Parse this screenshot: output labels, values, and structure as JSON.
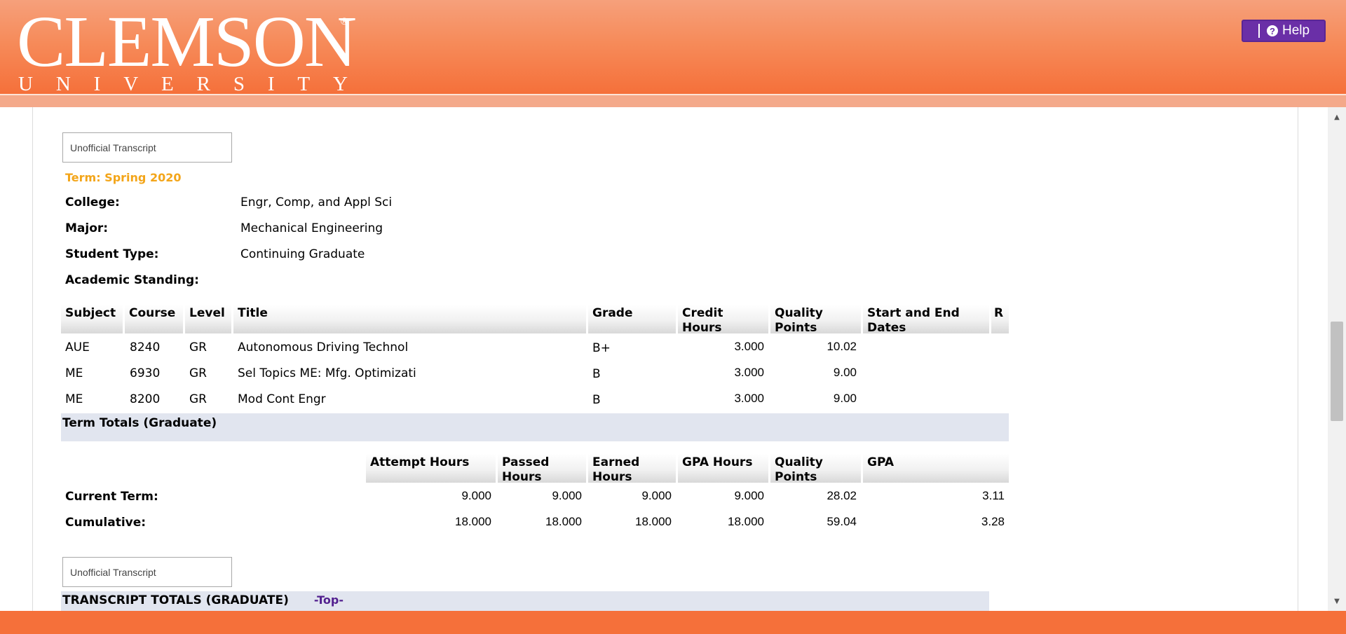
{
  "header": {
    "logo_main": "CLEMSON",
    "logo_sub": [
      "U",
      "N",
      "I",
      "V",
      "E",
      "R",
      "S",
      "I",
      "T",
      "Y"
    ],
    "logo_reg": "®",
    "help_label": "Help",
    "help_icon": "question-circle-icon"
  },
  "section1": {
    "title_box": "Unofficial Transcript",
    "term": "Term: Spring 2020",
    "info": [
      {
        "label": "College:",
        "value": "Engr, Comp, and Appl Sci"
      },
      {
        "label": "Major:",
        "value": "Mechanical Engineering"
      },
      {
        "label": "Student Type:",
        "value": "Continuing Graduate"
      },
      {
        "label": "Academic Standing:",
        "value": ""
      }
    ]
  },
  "courses": {
    "headers": [
      "Subject",
      "Course",
      "Level",
      "Title",
      "Grade",
      "Credit Hours",
      "Quality Points",
      "Start and End Dates",
      "R"
    ],
    "rows": [
      {
        "subject": "AUE",
        "course": "8240",
        "level": "GR",
        "title": "Autonomous Driving Technol",
        "grade": "B+",
        "credit": "3.000",
        "quality": "10.02"
      },
      {
        "subject": "ME",
        "course": "6930",
        "level": "GR",
        "title": "Sel Topics ME: Mfg. Optimizati",
        "grade": "B",
        "credit": "3.000",
        "quality": "9.00"
      },
      {
        "subject": "ME",
        "course": "8200",
        "level": "GR",
        "title": "Mod Cont Engr",
        "grade": "B",
        "credit": "3.000",
        "quality": "9.00"
      }
    ]
  },
  "term_totals": {
    "band": "Term Totals (Graduate)",
    "headers": [
      "Attempt Hours",
      "Passed Hours",
      "Earned Hours",
      "GPA Hours",
      "Quality Points",
      "GPA"
    ],
    "rows": [
      {
        "label": "Current Term:",
        "values": [
          "9.000",
          "9.000",
          "9.000",
          "9.000",
          "28.02",
          "3.11"
        ]
      },
      {
        "label": "Cumulative:",
        "values": [
          "18.000",
          "18.000",
          "18.000",
          "18.000",
          "59.04",
          "3.28"
        ]
      }
    ]
  },
  "section2": {
    "title_box": "Unofficial Transcript",
    "band": "TRANSCRIPT TOTALS (GRADUATE)",
    "top_link": "-Top-"
  },
  "colors": {
    "header_orange": "#f5703a",
    "term_gold": "#f3a519",
    "help_purple": "#6a2fa7",
    "band_blue": "#e1e5ef",
    "link_purple": "#52208f"
  }
}
